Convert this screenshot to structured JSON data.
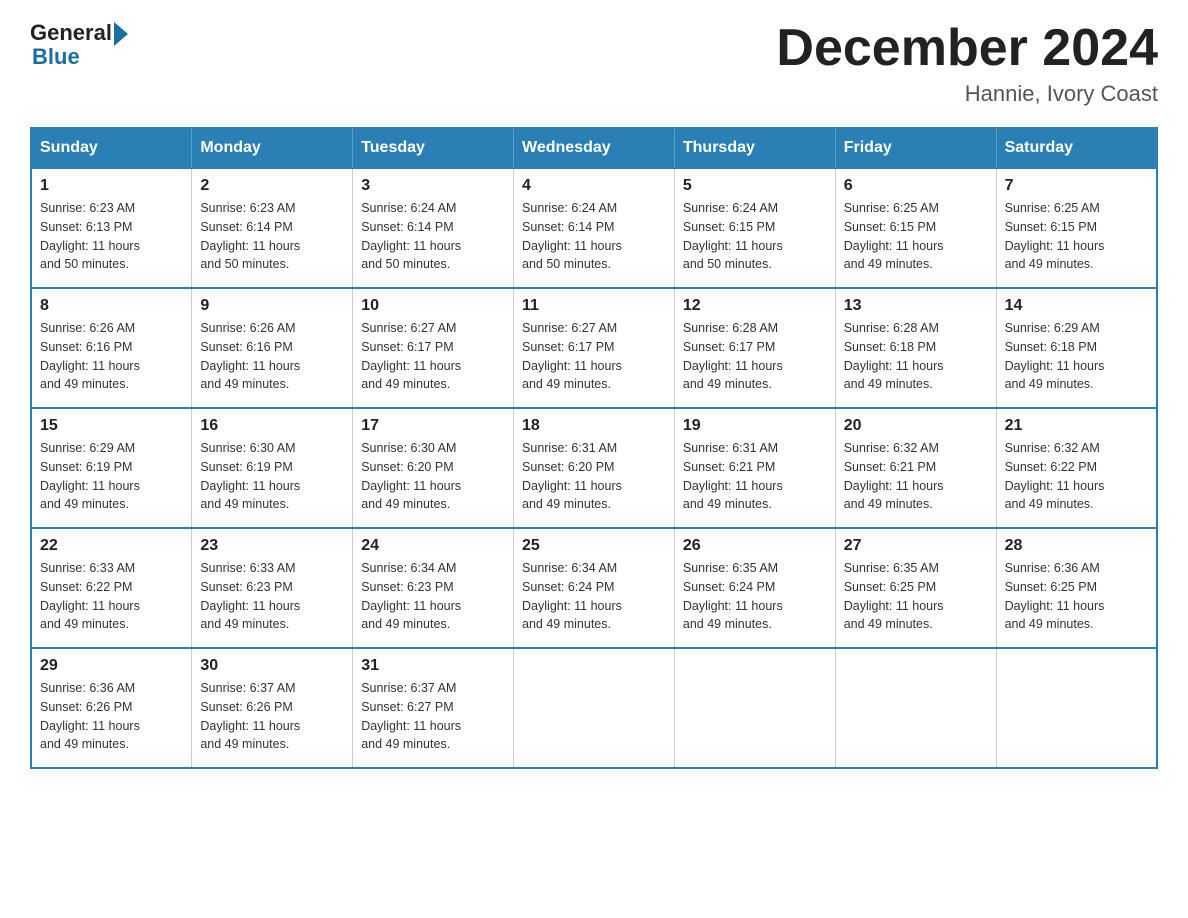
{
  "logo": {
    "general": "General",
    "blue": "Blue"
  },
  "title": "December 2024",
  "location": "Hannie, Ivory Coast",
  "days_of_week": [
    "Sunday",
    "Monday",
    "Tuesday",
    "Wednesday",
    "Thursday",
    "Friday",
    "Saturday"
  ],
  "weeks": [
    [
      {
        "day": "1",
        "sunrise": "6:23 AM",
        "sunset": "6:13 PM",
        "daylight": "11 hours and 50 minutes."
      },
      {
        "day": "2",
        "sunrise": "6:23 AM",
        "sunset": "6:14 PM",
        "daylight": "11 hours and 50 minutes."
      },
      {
        "day": "3",
        "sunrise": "6:24 AM",
        "sunset": "6:14 PM",
        "daylight": "11 hours and 50 minutes."
      },
      {
        "day": "4",
        "sunrise": "6:24 AM",
        "sunset": "6:14 PM",
        "daylight": "11 hours and 50 minutes."
      },
      {
        "day": "5",
        "sunrise": "6:24 AM",
        "sunset": "6:15 PM",
        "daylight": "11 hours and 50 minutes."
      },
      {
        "day": "6",
        "sunrise": "6:25 AM",
        "sunset": "6:15 PM",
        "daylight": "11 hours and 49 minutes."
      },
      {
        "day": "7",
        "sunrise": "6:25 AM",
        "sunset": "6:15 PM",
        "daylight": "11 hours and 49 minutes."
      }
    ],
    [
      {
        "day": "8",
        "sunrise": "6:26 AM",
        "sunset": "6:16 PM",
        "daylight": "11 hours and 49 minutes."
      },
      {
        "day": "9",
        "sunrise": "6:26 AM",
        "sunset": "6:16 PM",
        "daylight": "11 hours and 49 minutes."
      },
      {
        "day": "10",
        "sunrise": "6:27 AM",
        "sunset": "6:17 PM",
        "daylight": "11 hours and 49 minutes."
      },
      {
        "day": "11",
        "sunrise": "6:27 AM",
        "sunset": "6:17 PM",
        "daylight": "11 hours and 49 minutes."
      },
      {
        "day": "12",
        "sunrise": "6:28 AM",
        "sunset": "6:17 PM",
        "daylight": "11 hours and 49 minutes."
      },
      {
        "day": "13",
        "sunrise": "6:28 AM",
        "sunset": "6:18 PM",
        "daylight": "11 hours and 49 minutes."
      },
      {
        "day": "14",
        "sunrise": "6:29 AM",
        "sunset": "6:18 PM",
        "daylight": "11 hours and 49 minutes."
      }
    ],
    [
      {
        "day": "15",
        "sunrise": "6:29 AM",
        "sunset": "6:19 PM",
        "daylight": "11 hours and 49 minutes."
      },
      {
        "day": "16",
        "sunrise": "6:30 AM",
        "sunset": "6:19 PM",
        "daylight": "11 hours and 49 minutes."
      },
      {
        "day": "17",
        "sunrise": "6:30 AM",
        "sunset": "6:20 PM",
        "daylight": "11 hours and 49 minutes."
      },
      {
        "day": "18",
        "sunrise": "6:31 AM",
        "sunset": "6:20 PM",
        "daylight": "11 hours and 49 minutes."
      },
      {
        "day": "19",
        "sunrise": "6:31 AM",
        "sunset": "6:21 PM",
        "daylight": "11 hours and 49 minutes."
      },
      {
        "day": "20",
        "sunrise": "6:32 AM",
        "sunset": "6:21 PM",
        "daylight": "11 hours and 49 minutes."
      },
      {
        "day": "21",
        "sunrise": "6:32 AM",
        "sunset": "6:22 PM",
        "daylight": "11 hours and 49 minutes."
      }
    ],
    [
      {
        "day": "22",
        "sunrise": "6:33 AM",
        "sunset": "6:22 PM",
        "daylight": "11 hours and 49 minutes."
      },
      {
        "day": "23",
        "sunrise": "6:33 AM",
        "sunset": "6:23 PM",
        "daylight": "11 hours and 49 minutes."
      },
      {
        "day": "24",
        "sunrise": "6:34 AM",
        "sunset": "6:23 PM",
        "daylight": "11 hours and 49 minutes."
      },
      {
        "day": "25",
        "sunrise": "6:34 AM",
        "sunset": "6:24 PM",
        "daylight": "11 hours and 49 minutes."
      },
      {
        "day": "26",
        "sunrise": "6:35 AM",
        "sunset": "6:24 PM",
        "daylight": "11 hours and 49 minutes."
      },
      {
        "day": "27",
        "sunrise": "6:35 AM",
        "sunset": "6:25 PM",
        "daylight": "11 hours and 49 minutes."
      },
      {
        "day": "28",
        "sunrise": "6:36 AM",
        "sunset": "6:25 PM",
        "daylight": "11 hours and 49 minutes."
      }
    ],
    [
      {
        "day": "29",
        "sunrise": "6:36 AM",
        "sunset": "6:26 PM",
        "daylight": "11 hours and 49 minutes."
      },
      {
        "day": "30",
        "sunrise": "6:37 AM",
        "sunset": "6:26 PM",
        "daylight": "11 hours and 49 minutes."
      },
      {
        "day": "31",
        "sunrise": "6:37 AM",
        "sunset": "6:27 PM",
        "daylight": "11 hours and 49 minutes."
      },
      null,
      null,
      null,
      null
    ]
  ],
  "labels": {
    "sunrise": "Sunrise:",
    "sunset": "Sunset:",
    "daylight": "Daylight:"
  },
  "colors": {
    "header_bg": "#2a7fb5",
    "header_text": "#ffffff",
    "border": "#2a7fb5",
    "logo_blue": "#1a6fa0"
  }
}
